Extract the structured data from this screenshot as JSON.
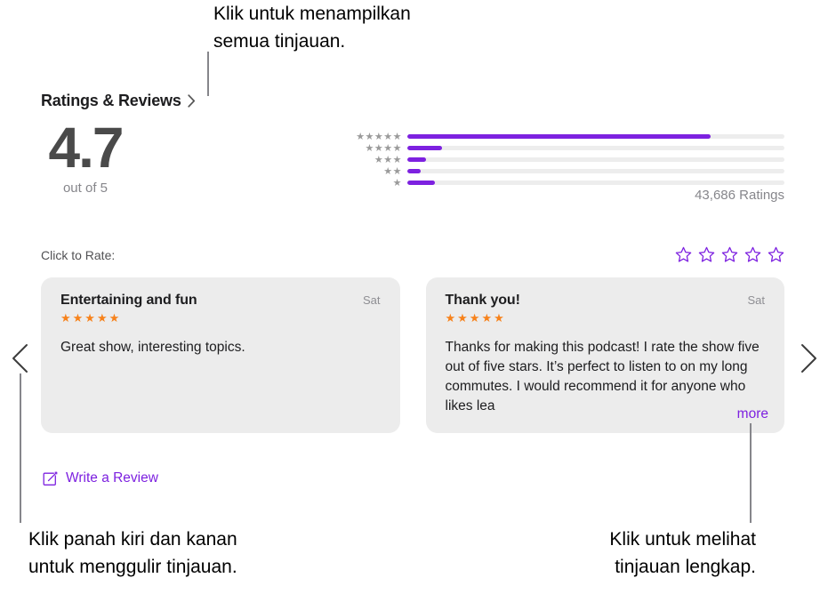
{
  "annotations": {
    "top": "Klik untuk menampilkan\nsemua tinjauan.",
    "bottom_left": "Klik panah kiri dan kanan\nuntuk menggulir tinjauan.",
    "bottom_right": "Klik untuk melihat\ntinjauan lengkap."
  },
  "section": {
    "title": "Ratings & Reviews",
    "disclosure_icon": "chevron-right-icon"
  },
  "score": {
    "value": "4.7",
    "out_of": "out of 5"
  },
  "histogram": {
    "ratings_count": "43,686 Ratings",
    "rows": [
      {
        "stars": "★★★★★",
        "star_count": 5,
        "percent": 80.5
      },
      {
        "stars": "★★★★",
        "star_count": 4,
        "percent": 9.2
      },
      {
        "stars": "★★★",
        "star_count": 3,
        "percent": 5.0
      },
      {
        "stars": "★★",
        "star_count": 2,
        "percent": 3.6
      },
      {
        "stars": "★",
        "star_count": 1,
        "percent": 7.4
      }
    ],
    "bar_color": "#7d21e0",
    "track_color": "#ededed"
  },
  "rate": {
    "label": "Click to Rate:",
    "star_count": 5,
    "star_color": "#7d21e0"
  },
  "reviews": [
    {
      "title": "Entertaining and fun",
      "date": "Sat",
      "stars": "★★★★★",
      "body": "Great show, interesting topics.",
      "more_label": ""
    },
    {
      "title": "Thank you!",
      "date": "Sat",
      "stars": "★★★★★",
      "body": "Thanks for making this podcast! I rate the show five out of five stars. It’s perfect to listen to on my long commutes. I would recommend it for anyone who likes lea",
      "more_label": "more"
    }
  ],
  "write_review": {
    "label": "Write a Review",
    "icon": "compose-icon"
  },
  "nav": {
    "previous_icon": "chevron-left-icon",
    "next_icon": "chevron-right-icon"
  },
  "colors": {
    "accent_purple": "#7d21e0",
    "star_orange": "#f7821b",
    "card_bg": "#ececec"
  }
}
